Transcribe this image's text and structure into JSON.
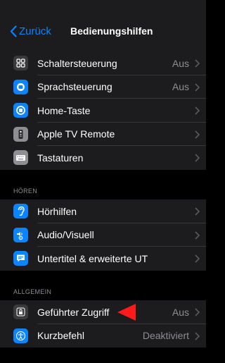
{
  "nav": {
    "back_label": "Zurück",
    "title": "Bedienungshilfen"
  },
  "groups": [
    {
      "rows": [
        {
          "label": "Schaltersteuerung",
          "value": "Aus",
          "icon": "switch-control-icon",
          "icon_color": "#3a3a3c"
        },
        {
          "label": "Sprachsteuerung",
          "value": "Aus",
          "icon": "voice-control-icon",
          "icon_color": "#0a84ff"
        },
        {
          "label": "Home-Taste",
          "value": "",
          "icon": "home-button-icon",
          "icon_color": "#0a84ff"
        },
        {
          "label": "Apple TV Remote",
          "value": "",
          "icon": "tv-remote-icon",
          "icon_color": "#8e8e93"
        },
        {
          "label": "Tastaturen",
          "value": "",
          "icon": "keyboard-icon",
          "icon_color": "#8e8e93"
        }
      ]
    },
    {
      "header": "HÖREN",
      "rows": [
        {
          "label": "Hörhilfen",
          "value": "",
          "icon": "hearing-aid-icon",
          "icon_color": "#0a84ff"
        },
        {
          "label": "Audio/Visuell",
          "value": "",
          "icon": "audio-visual-icon",
          "icon_color": "#0a84ff"
        },
        {
          "label": "Untertitel & erweiterte UT",
          "value": "",
          "icon": "subtitles-icon",
          "icon_color": "#0a84ff"
        }
      ]
    },
    {
      "header": "ALLGEMEIN",
      "rows": [
        {
          "label": "Geführter Zugriff",
          "value": "Aus",
          "icon": "guided-access-icon",
          "icon_color": "#3a3a3c"
        },
        {
          "label": "Kurzbefehl",
          "value": "Deaktiviert",
          "icon": "accessibility-shortcut-icon",
          "icon_color": "#0a84ff"
        }
      ]
    }
  ],
  "annotation": {
    "icon": "red-arrow-icon",
    "color": "#ff1a1a"
  }
}
